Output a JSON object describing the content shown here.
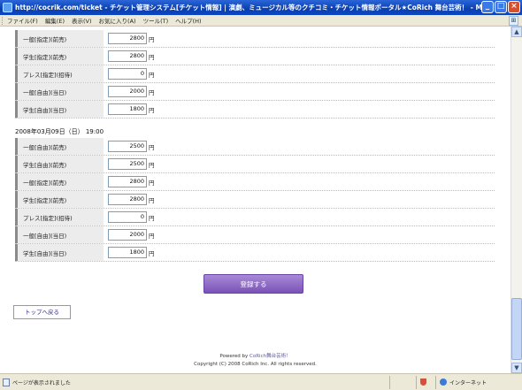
{
  "window": {
    "title": "http://cocrik.com/ticket - チケット管理システム[チケット情報] | 演劇、ミュージカル等のクチコミ・チケット情報ポータル★CoRich 舞台芸術！ - Microsoft I...",
    "btn_min": "_",
    "btn_max": "□",
    "btn_close": "×"
  },
  "menu": {
    "items": [
      "ファイル(F)",
      "編集(E)",
      "表示(V)",
      "お気に入り(A)",
      "ツール(T)",
      "ヘルプ(H)"
    ],
    "logo": "⊞"
  },
  "section1": {
    "rows": [
      {
        "label": "一般[指定](前売)",
        "value": "2800",
        "unit": "円"
      },
      {
        "label": "学生[指定](前売)",
        "value": "2800",
        "unit": "円"
      },
      {
        "label": "プレス[指定](招待)",
        "value": "0",
        "unit": "円"
      },
      {
        "label": "一般[自由](当日)",
        "value": "2000",
        "unit": "円"
      },
      {
        "label": "学生[自由](当日)",
        "value": "1800",
        "unit": "円"
      }
    ]
  },
  "date_heading": "2008年03月09日（日） 19:00",
  "section2": {
    "rows": [
      {
        "label": "一般[自由](前売)",
        "value": "2500",
        "unit": "円"
      },
      {
        "label": "学生[自由](前売)",
        "value": "2500",
        "unit": "円"
      },
      {
        "label": "一般[指定](前売)",
        "value": "2800",
        "unit": "円"
      },
      {
        "label": "学生[指定](前売)",
        "value": "2800",
        "unit": "円"
      },
      {
        "label": "プレス[指定](招待)",
        "value": "0",
        "unit": "円"
      },
      {
        "label": "一般[自由](当日)",
        "value": "2000",
        "unit": "円"
      },
      {
        "label": "学生[自由](当日)",
        "value": "1800",
        "unit": "円"
      }
    ]
  },
  "buttons": {
    "submit": "登録する",
    "back": "トップへ戻る"
  },
  "footer": {
    "powered_prefix": "Powered by",
    "powered_link": "CoRich舞台芸術！",
    "copyright": "Copyright (C) 2008 CoRich Inc. All rights reserved."
  },
  "statusbar": {
    "text": "ページが表示されました",
    "zone": "インターネット"
  }
}
